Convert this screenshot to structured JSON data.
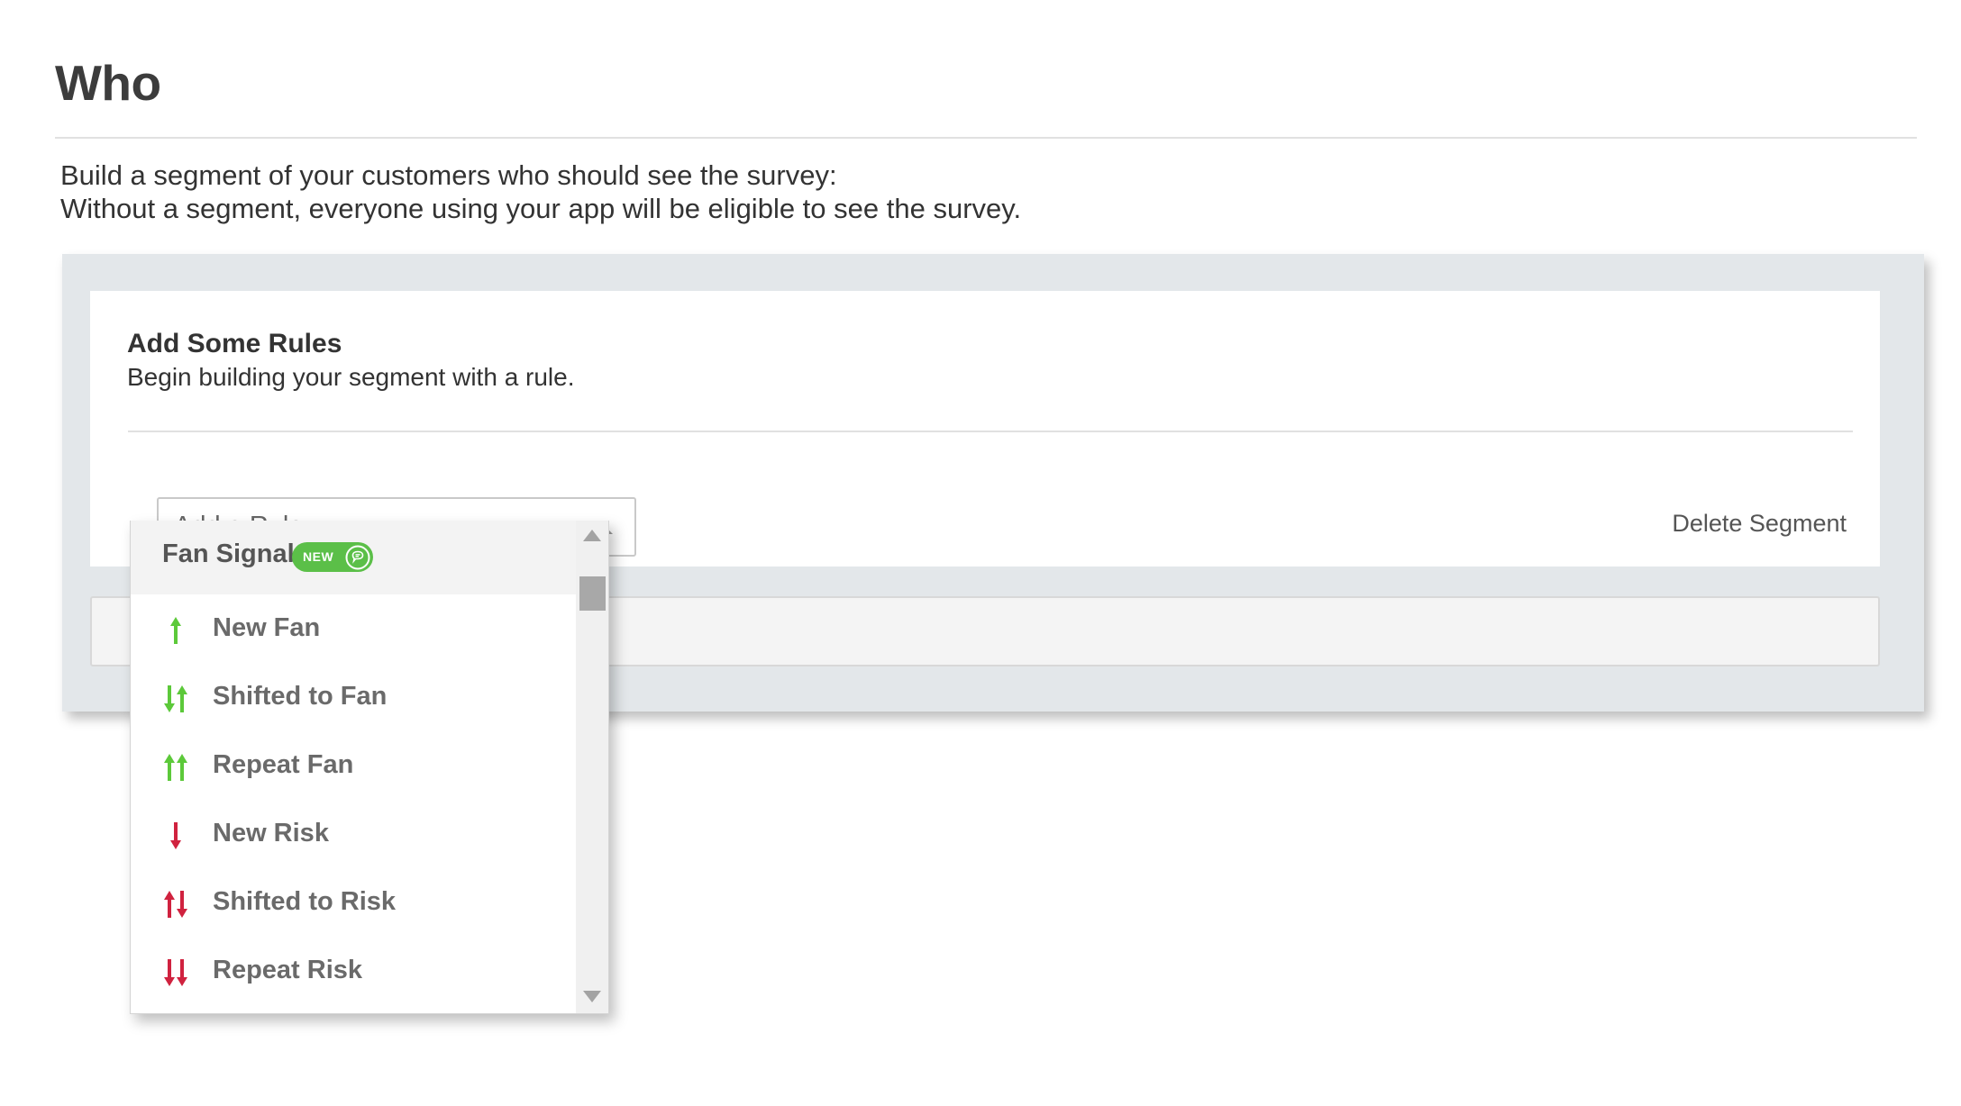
{
  "page": {
    "title": "Who",
    "intro_line1": "Build a segment of your customers who should see the survey:",
    "intro_line2": "Without a segment, everyone using your app will be eligible to see the survey."
  },
  "rules_card": {
    "title": "Add Some Rules",
    "subtitle": "Begin building your segment with a rule.",
    "delete_label": "Delete Segment"
  },
  "rule_select": {
    "placeholder": "Add a Rule...",
    "open": true
  },
  "dropdown": {
    "group_label": "Fan Signals",
    "badge": "NEW",
    "options": [
      {
        "label": "New Fan",
        "icon": "arrow-up-icon"
      },
      {
        "label": "Shifted to Fan",
        "icon": "arrow-down-up-icon"
      },
      {
        "label": "Repeat Fan",
        "icon": "double-arrow-up-icon"
      },
      {
        "label": "New Risk",
        "icon": "arrow-down-icon"
      },
      {
        "label": "Shifted to Risk",
        "icon": "arrow-up-down-icon"
      },
      {
        "label": "Repeat Risk",
        "icon": "double-arrow-down-icon"
      }
    ]
  },
  "colors": {
    "fan": "#5cc93a",
    "risk": "#d0223f",
    "badge": "#5bbf48",
    "panel": "#e3e7ea"
  }
}
